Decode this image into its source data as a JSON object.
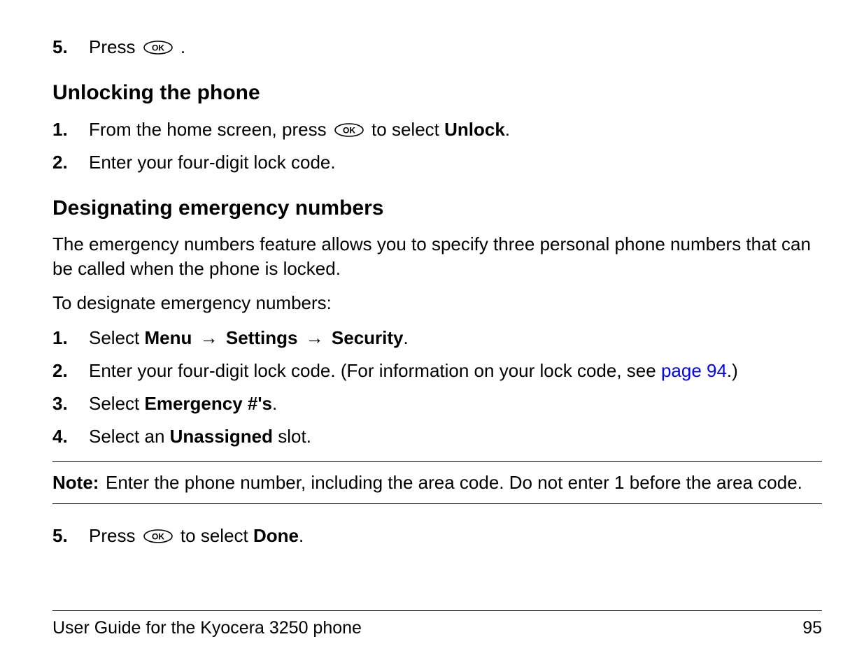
{
  "top_step": {
    "num": "5.",
    "prefix": "Press ",
    "suffix": "."
  },
  "section_unlock": {
    "heading": "Unlocking the phone",
    "steps": [
      {
        "num": "1.",
        "prefix": "From the home screen, press ",
        "middle": " to select ",
        "bold": "Unlock",
        "suffix": "."
      },
      {
        "num": "2.",
        "text": "Enter your four-digit lock code."
      }
    ]
  },
  "section_emergency": {
    "heading": "Designating emergency numbers",
    "intro1": "The emergency numbers feature allows you to specify three personal phone numbers that can be called when the phone is locked.",
    "intro2": "To designate emergency numbers:",
    "steps": {
      "s1": {
        "num": "1.",
        "prefix": "Select ",
        "b1": "Menu",
        "b2": "Settings",
        "b3": "Security",
        "suffix": "."
      },
      "s2": {
        "num": "2.",
        "prefix": "Enter your four-digit lock code. (For information on your lock code, see ",
        "link": "page 94",
        "suffix": ".)"
      },
      "s3": {
        "num": "3.",
        "prefix": "Select ",
        "bold": "Emergency #'s",
        "suffix": "."
      },
      "s4": {
        "num": "4.",
        "prefix": "Select an ",
        "bold": "Unassigned",
        "suffix": " slot."
      }
    },
    "note": {
      "label": "Note:",
      "text": "Enter the phone number, including the area code. Do not enter 1 before the area code."
    },
    "s5": {
      "num": "5.",
      "prefix": "Press ",
      "middle": " to select ",
      "bold": "Done",
      "suffix": "."
    }
  },
  "footer": {
    "left": "User Guide for the Kyocera 3250 phone",
    "right": "95"
  },
  "arrow": "→"
}
